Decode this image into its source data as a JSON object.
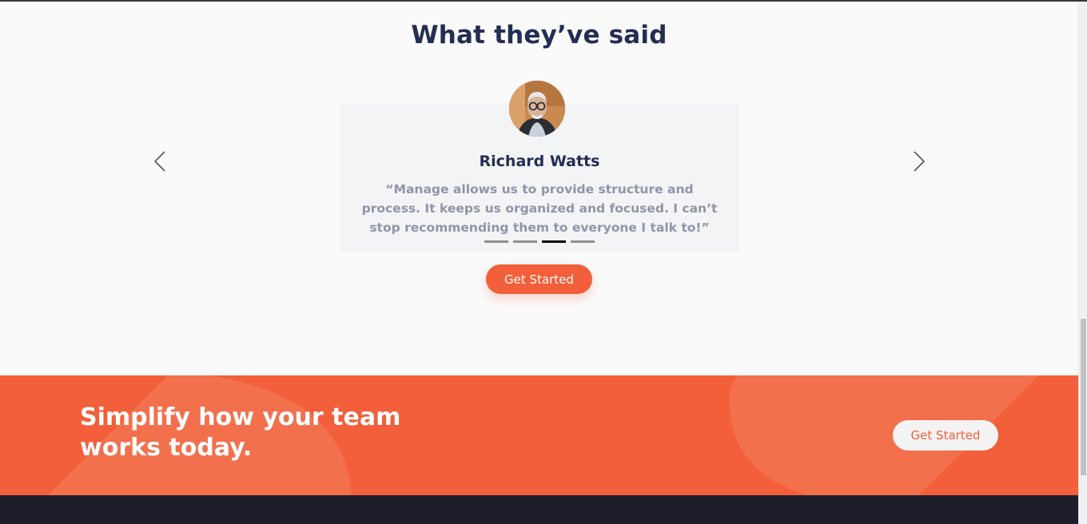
{
  "testimonials": {
    "title": "What they’ve said",
    "reviewer": {
      "name": "Richard Watts",
      "quote": "“Manage allows us to provide structure and process. It keeps us organized and focused. I can’t stop recommending them to everyone I talk to!”"
    },
    "carousel": {
      "slide_count": 4,
      "active_index": 2
    },
    "cta_label": "Get Started"
  },
  "banner": {
    "title": "Simplify how your team works today.",
    "cta_label": "Get Started"
  },
  "colors": {
    "accent": "#f25f3a",
    "heading": "#242d52",
    "muted_text": "#9095a7",
    "footer_bg": "#1d1e29"
  },
  "icons": {
    "prev": "chevron-left-icon",
    "next": "chevron-right-icon"
  }
}
